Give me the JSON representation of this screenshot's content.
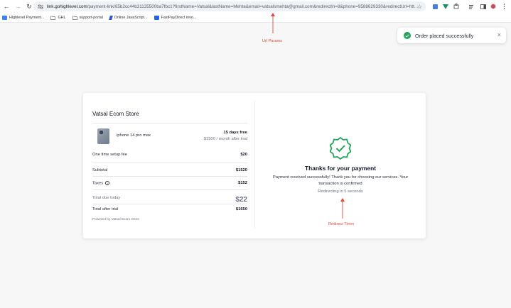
{
  "browser": {
    "url_host": "link.gohighlevel.com",
    "url_path": "/payment-link/65b2cc44b31135500ba7fbc1?firstName=Vatsal&lastName=Mehta&email=vatsalsmehta@gmail.com&redirectIn=8&phone=9588629330&redirectUrl=htt...",
    "bookmarks": [
      {
        "label": "Highlevel Payment..."
      },
      {
        "label": "GHL"
      },
      {
        "label": "support-portal"
      },
      {
        "label": "Online JavaScript..."
      },
      {
        "label": "FastPayDirect invo..."
      }
    ]
  },
  "toast": {
    "message": "Order placed successfully"
  },
  "annotations": {
    "url_params": "Url Params",
    "redirect_timer": "Redirect Timer"
  },
  "order": {
    "store_name": "Vatsal Ecom Store",
    "product_name": "iphone 14 pro max",
    "trial_label": "15 days free",
    "trial_sub": "$1500 / month after trial",
    "setup_fee_label": "One time setup fee",
    "setup_fee_value": "$20",
    "subtotal_label": "Subtotal",
    "subtotal_value": "$1520",
    "taxes_label": "Taxes",
    "taxes_value": "$152",
    "total_due_label": "Total due today",
    "total_due_value": "$22",
    "after_trial_label": "Total after trial",
    "after_trial_value": "$1650",
    "powered_by": "Powered by Vatsal Ecom Store"
  },
  "confirmation": {
    "title": "Thanks for your payment",
    "message": "Payment received successfully! Thank you for choosing our services. Your transaction is confirmed",
    "redirect_text": "Redirecting in 5 seconds"
  },
  "colors": {
    "success": "#22a559",
    "annotation": "#e3463b"
  }
}
